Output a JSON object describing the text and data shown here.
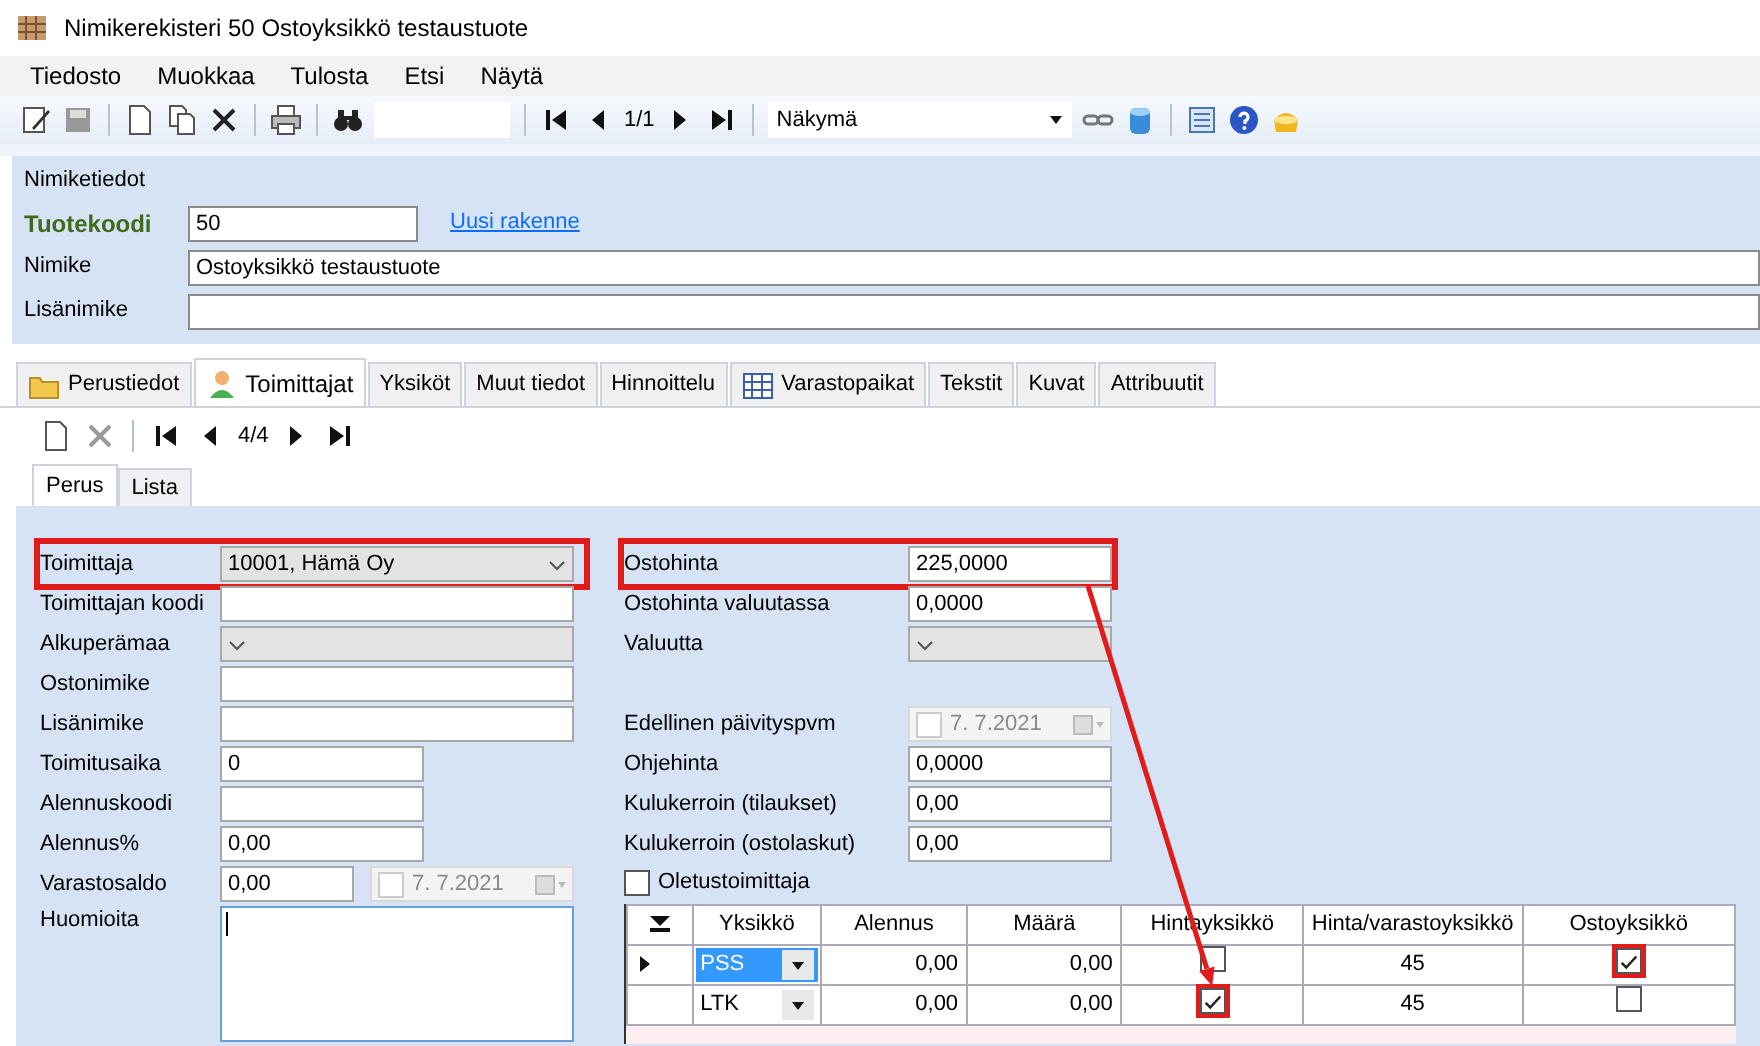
{
  "window": {
    "title": "Nimikerekisteri 50 Ostoyksikkö testaustuote"
  },
  "menu": [
    "Tiedosto",
    "Muokkaa",
    "Tulosta",
    "Etsi",
    "Näytä"
  ],
  "toolbar": {
    "record_position": "1/1",
    "view_select": "Näkymä"
  },
  "item_group": {
    "title": "Nimiketiedot",
    "product_code_label": "Tuotekoodi",
    "product_code": "50",
    "link": "Uusi rakenne",
    "name_label": "Nimike",
    "name": "Ostoyksikkö testaustuote",
    "extra_name_label": "Lisänimike"
  },
  "tabs": [
    {
      "label": "Perustiedot",
      "selected": false
    },
    {
      "label": "Toimittajat",
      "selected": true
    },
    {
      "label": "Yksiköt",
      "selected": false
    },
    {
      "label": "Muut tiedot",
      "selected": false
    },
    {
      "label": "Hinnoittelu",
      "selected": false
    },
    {
      "label": "Varastopaikat",
      "selected": false
    },
    {
      "label": "Tekstit",
      "selected": false
    },
    {
      "label": "Kuvat",
      "selected": false
    },
    {
      "label": "Attribuutit",
      "selected": false
    }
  ],
  "record_nav": {
    "position": "4/4"
  },
  "subtabs": [
    {
      "label": "Perus",
      "selected": true
    },
    {
      "label": "Lista",
      "selected": false
    }
  ],
  "left_fields": [
    {
      "label": "Toimittaja",
      "kind": "select",
      "value": "10001, Hämä  Oy",
      "highlighted": true
    },
    {
      "label": "Toimittajan koodi",
      "kind": "text"
    },
    {
      "label": "Alkuperämaa",
      "kind": "select"
    },
    {
      "label": "Ostonimike",
      "kind": "text"
    },
    {
      "label": "Lisänimike",
      "kind": "text"
    },
    {
      "label": "Toimitusaika",
      "kind": "short",
      "value": "0"
    },
    {
      "label": "Alennuskoodi",
      "kind": "short"
    },
    {
      "label": "Alennus%",
      "kind": "short",
      "value": "0,00"
    },
    {
      "label": "Varastosaldo",
      "kind": "split",
      "value": "0,00",
      "date": "7. 7.2021",
      "disabled": true
    },
    {
      "label": "Huomioita",
      "kind": "textarea",
      "focused": true
    }
  ],
  "right_fields": [
    {
      "label": "Ostohinta",
      "kind": "text",
      "value": "225,0000",
      "highlighted": true
    },
    {
      "label": "Ostohinta valuutassa",
      "kind": "text",
      "value": "0,0000"
    },
    {
      "label": "Valuutta",
      "kind": "select"
    },
    {
      "label": "Edellinen päivityspvm",
      "kind": "date",
      "date": "7. 7.2021",
      "disabled": true
    },
    {
      "label": "Ohjehinta",
      "kind": "text",
      "value": "0,0000"
    },
    {
      "label": "Kulukerroin (tilaukset)",
      "kind": "text",
      "value": "0,00"
    },
    {
      "label": "Kulukerroin (ostolaskut)",
      "kind": "text",
      "value": "0,00"
    }
  ],
  "default_supplier": {
    "label": "Oletustoimittaja",
    "checked": false
  },
  "grid": {
    "columns": [
      "Yksikkö",
      "Alennus",
      "Määrä",
      "Hintayksikkö",
      "Hinta/varastoyksikkö",
      "Ostoyksikkö"
    ],
    "rows": [
      {
        "current": true,
        "unit": "PSS",
        "unit_selected": true,
        "discount": "0,00",
        "quantity": "0,00",
        "price_unit": false,
        "price_unit_highlighted": false,
        "price_per_stock_unit": "45",
        "purchase_unit": true,
        "purchase_unit_highlighted": true
      },
      {
        "current": false,
        "unit": "LTK",
        "unit_selected": false,
        "discount": "0,00",
        "quantity": "0,00",
        "price_unit": true,
        "price_unit_highlighted": true,
        "price_per_stock_unit": "45",
        "purchase_unit": false,
        "purchase_unit_highlighted": false
      }
    ]
  },
  "annotation_arrow": true
}
